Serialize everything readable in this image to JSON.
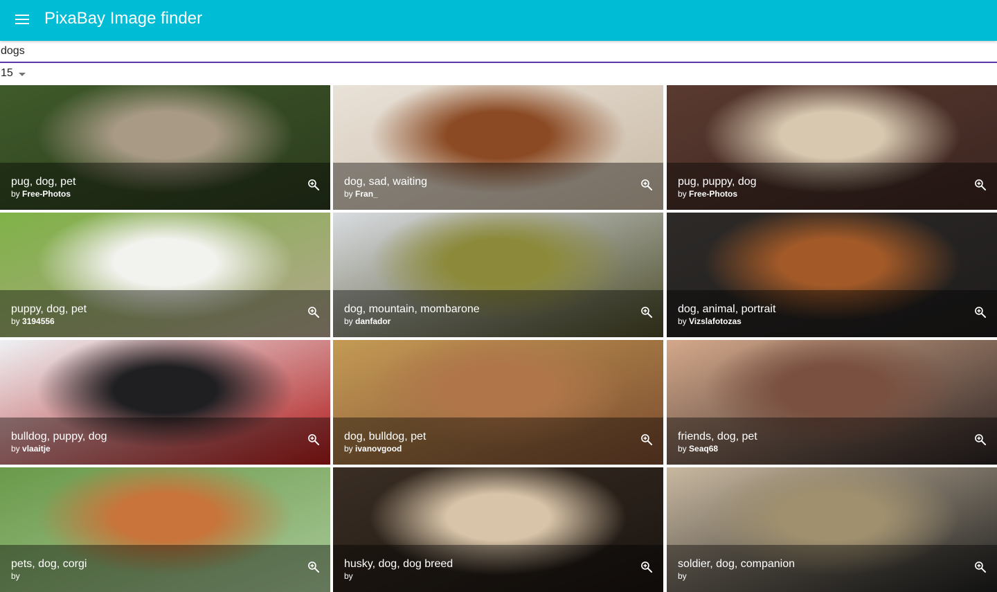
{
  "appbar": {
    "title": "PixaBay Image finder",
    "color": "#00bcd4",
    "menu_icon": "menu-icon"
  },
  "search": {
    "value": "dogs",
    "underline_color": "#5e35b1"
  },
  "amount": {
    "selected": "15"
  },
  "images": [
    {
      "tags": "pug, dog, pet",
      "by": "by",
      "user": "Free-Photos",
      "c1": "#3f5a2a",
      "c2": "#a89a85",
      "c3": "#2b3a1d"
    },
    {
      "tags": "dog, sad, waiting",
      "by": "by",
      "user": "Fran_",
      "c1": "#e9e2d8",
      "c2": "#8b4a24",
      "c3": "#c9b9a5"
    },
    {
      "tags": "pug, puppy, dog",
      "by": "by",
      "user": "Free-Photos",
      "c1": "#5a3a30",
      "c2": "#d8c8b0",
      "c3": "#3a2520"
    },
    {
      "tags": "puppy, dog, pet",
      "by": "by",
      "user": "3194556",
      "c1": "#7fb247",
      "c2": "#f2f2ee",
      "c3": "#b5a690"
    },
    {
      "tags": "dog, mountain, mombarone",
      "by": "by",
      "user": "danfador",
      "c1": "#d9dce0",
      "c2": "#8c8a3a",
      "c3": "#4a4a26"
    },
    {
      "tags": "dog, animal, portrait",
      "by": "by",
      "user": "Vizslafotozas",
      "c1": "#2d2a28",
      "c2": "#a35a28",
      "c3": "#1e1c1b"
    },
    {
      "tags": "bulldog, puppy, dog",
      "by": "by",
      "user": "vlaaitje",
      "c1": "#eef1f4",
      "c2": "#1f1f22",
      "c3": "#b01818"
    },
    {
      "tags": "dog, bulldog, pet",
      "by": "by",
      "user": "ivanovgood",
      "c1": "#c49a55",
      "c2": "#b0764a",
      "c3": "#7a4a2e"
    },
    {
      "tags": "friends, dog, pet",
      "by": "by",
      "user": "Seaq68",
      "c1": "#d4a88a",
      "c2": "#7a5040",
      "c3": "#2a2222"
    },
    {
      "tags": "pets, dog, corgi",
      "by": "by",
      "user": "",
      "c1": "#6a9a4a",
      "c2": "#c8743a",
      "c3": "#a8c898"
    },
    {
      "tags": "husky, dog, dog breed",
      "by": "by",
      "user": "",
      "c1": "#3a2e24",
      "c2": "#d8c4a8",
      "c3": "#1a1410"
    },
    {
      "tags": "soldier, dog, companion",
      "by": "by",
      "user": "",
      "c1": "#c8b8a0",
      "c2": "#a0906e",
      "c3": "#1e1e1e"
    }
  ]
}
